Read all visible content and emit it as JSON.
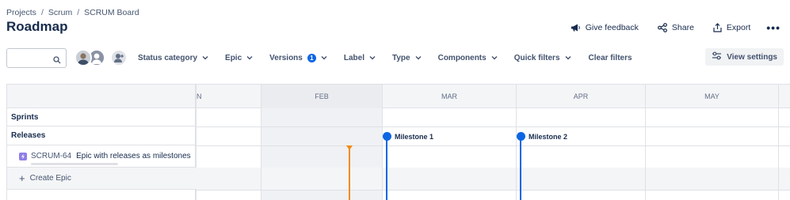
{
  "breadcrumb": {
    "items": [
      "Projects",
      "Scrum",
      "SCRUM Board"
    ],
    "separator": "/"
  },
  "page_title": "Roadmap",
  "header_actions": {
    "feedback_label": "Give feedback",
    "share_label": "Share",
    "export_label": "Export",
    "more_label": "•••"
  },
  "toolbar": {
    "search_placeholder": "",
    "filters": [
      {
        "label": "Status category"
      },
      {
        "label": "Epic"
      },
      {
        "label": "Versions",
        "badge": "1"
      },
      {
        "label": "Label"
      },
      {
        "label": "Type"
      },
      {
        "label": "Components"
      },
      {
        "label": "Quick filters"
      }
    ],
    "clear_filters_label": "Clear filters",
    "view_settings_label": "View settings"
  },
  "roadmap": {
    "months": [
      "N",
      "FEB",
      "MAR",
      "APR",
      "MAY"
    ],
    "rows": {
      "sprints_label": "Sprints",
      "releases_label": "Releases",
      "epic_key": "SCRUM-64",
      "epic_summary": "Epic with releases as milestones",
      "create_epic_label": "Create Epic",
      "create_epic_plus": "+"
    },
    "milestones": [
      {
        "label": "Milestone 1"
      },
      {
        "label": "Milestone 2"
      }
    ]
  },
  "colors": {
    "accent_blue": "#0c66e4",
    "today_orange": "#f18d13",
    "epic_purple": "#8f7ee7",
    "text_primary": "#172b4d",
    "text_subtle": "#42526e"
  },
  "icons": {
    "search": "search-icon",
    "feedback": "megaphone-icon",
    "share": "share-icon",
    "export": "export-icon",
    "view_settings": "sliders-icon",
    "epic": "lightning-icon",
    "chevron": "chevron-down-icon"
  }
}
